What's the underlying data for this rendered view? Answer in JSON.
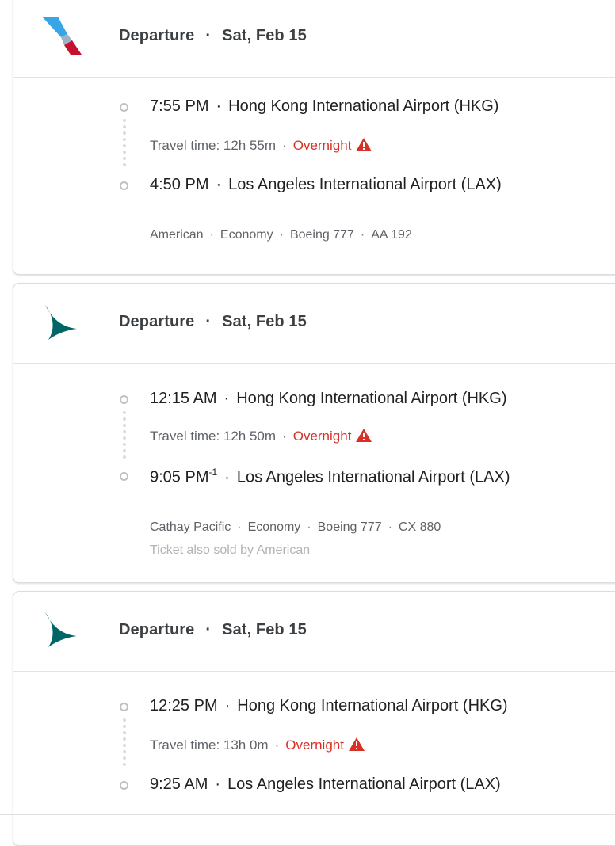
{
  "flights": [
    {
      "airline_logo": "american-airlines-logo",
      "departure_label": "Departure",
      "date": "Sat, Feb 15",
      "depart_time": "7:55 PM",
      "depart_airport": "Hong Kong International Airport (HKG)",
      "travel_time": "Travel time: 12h 55m",
      "overnight": "Overnight",
      "arrive_time": "4:50 PM",
      "arrive_day_offset": "",
      "arrive_airport": "Los Angeles International Airport (LAX)",
      "airline": "American",
      "cabin": "Economy",
      "aircraft": "Boeing 777",
      "flight_number": "AA 192",
      "sold_by": ""
    },
    {
      "airline_logo": "cathay-pacific-logo",
      "departure_label": "Departure",
      "date": "Sat, Feb 15",
      "depart_time": "12:15 AM",
      "depart_airport": "Hong Kong International Airport (HKG)",
      "travel_time": "Travel time: 12h 50m",
      "overnight": "Overnight",
      "arrive_time": "9:05 PM",
      "arrive_day_offset": "-1",
      "arrive_airport": "Los Angeles International Airport (LAX)",
      "airline": "Cathay Pacific",
      "cabin": "Economy",
      "aircraft": "Boeing 777",
      "flight_number": "CX 880",
      "sold_by": "Ticket also sold by American"
    },
    {
      "airline_logo": "cathay-pacific-logo",
      "departure_label": "Departure",
      "date": "Sat, Feb 15",
      "depart_time": "12:25 PM",
      "depart_airport": "Hong Kong International Airport (HKG)",
      "travel_time": "Travel time: 13h 0m",
      "overnight": "Overnight",
      "arrive_time": "9:25 AM",
      "arrive_day_offset": "",
      "arrive_airport": "Los Angeles International Airport (LAX)",
      "airline": "",
      "cabin": "",
      "aircraft": "",
      "flight_number": "",
      "sold_by": ""
    }
  ],
  "separator": "·",
  "colors": {
    "overnight": "#d93025",
    "cathay_teal": "#006564",
    "american_red": "#c30019",
    "american_blue": "#0078d2"
  },
  "icons": [
    "warning-icon",
    "stop-circle-icon"
  ]
}
